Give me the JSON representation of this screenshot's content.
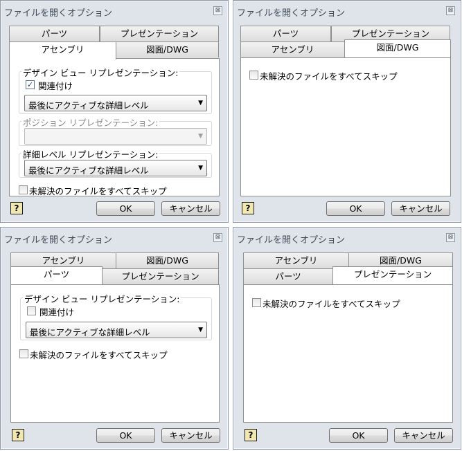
{
  "window_title": "ファイルを開くオプション",
  "close_glyph": "⊠",
  "tabs": {
    "parts": "パーツ",
    "presentation": "プレゼンテーション",
    "assembly": "アセンブリ",
    "drawing": "図面/DWG"
  },
  "assembly_options": {
    "design_view_label": "デザイン ビュー リプレゼンテーション:",
    "associative_label": "関連付け",
    "design_view_value": "最後にアクティブな詳細レベル",
    "position_label": "ポジション リプレゼンテーション:",
    "position_value": "",
    "lod_label": "詳細レベル リプレゼンテーション:",
    "lod_value": "最後にアクティブな詳細レベル"
  },
  "parts_options": {
    "design_view_label": "デザイン ビュー リプレゼンテーション:",
    "associative_label": "関連付け",
    "design_view_value": "最後にアクティブな詳細レベル"
  },
  "skip_unresolved_label": "未解決のファイルをすべてスキップ",
  "check_mark": "✓",
  "help_glyph": "?",
  "dropdown_arrow": "▼",
  "ok_label": "OK",
  "cancel_label": "キャンセル"
}
